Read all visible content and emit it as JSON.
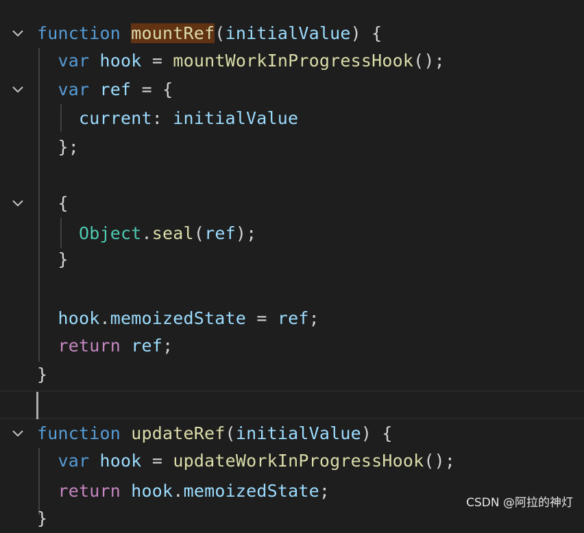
{
  "editor": {
    "lines": [
      {
        "fold": true,
        "tokens": [
          {
            "t": "function",
            "c": "kw"
          },
          {
            "t": " ",
            "c": "pun"
          },
          {
            "t": "mountRef",
            "c": "fn hl"
          },
          {
            "t": "(",
            "c": "pun"
          },
          {
            "t": "initialValue",
            "c": "var"
          },
          {
            "t": ") {",
            "c": "pun"
          }
        ]
      },
      {
        "fold": false,
        "tokens": [
          {
            "t": "  ",
            "c": "pun"
          },
          {
            "t": "var",
            "c": "kw"
          },
          {
            "t": " ",
            "c": "pun"
          },
          {
            "t": "hook",
            "c": "var"
          },
          {
            "t": " = ",
            "c": "pun"
          },
          {
            "t": "mountWorkInProgressHook",
            "c": "fn"
          },
          {
            "t": "();",
            "c": "pun"
          }
        ]
      },
      {
        "fold": true,
        "tokens": [
          {
            "t": "  ",
            "c": "pun"
          },
          {
            "t": "var",
            "c": "kw"
          },
          {
            "t": " ",
            "c": "pun"
          },
          {
            "t": "ref",
            "c": "var"
          },
          {
            "t": " = {",
            "c": "pun"
          }
        ]
      },
      {
        "fold": false,
        "tokens": [
          {
            "t": "    ",
            "c": "pun"
          },
          {
            "t": "current",
            "c": "var"
          },
          {
            "t": ": ",
            "c": "pun"
          },
          {
            "t": "initialValue",
            "c": "var"
          }
        ]
      },
      {
        "fold": false,
        "tokens": [
          {
            "t": "  ",
            "c": "pun"
          },
          {
            "t": "};",
            "c": "pun"
          }
        ]
      },
      {
        "fold": false,
        "tokens": []
      },
      {
        "fold": true,
        "tokens": [
          {
            "t": "  ",
            "c": "pun"
          },
          {
            "t": "{",
            "c": "pun"
          }
        ]
      },
      {
        "fold": false,
        "tokens": [
          {
            "t": "    ",
            "c": "pun"
          },
          {
            "t": "Object",
            "c": "cls"
          },
          {
            "t": ".",
            "c": "pun"
          },
          {
            "t": "seal",
            "c": "fn"
          },
          {
            "t": "(",
            "c": "pun"
          },
          {
            "t": "ref",
            "c": "var"
          },
          {
            "t": ");",
            "c": "pun"
          }
        ]
      },
      {
        "fold": false,
        "tokens": [
          {
            "t": "  ",
            "c": "pun"
          },
          {
            "t": "}",
            "c": "pun"
          }
        ]
      },
      {
        "fold": false,
        "tokens": []
      },
      {
        "fold": false,
        "tokens": [
          {
            "t": "  ",
            "c": "pun"
          },
          {
            "t": "hook",
            "c": "var"
          },
          {
            "t": ".",
            "c": "pun"
          },
          {
            "t": "memoizedState",
            "c": "var"
          },
          {
            "t": " = ",
            "c": "pun"
          },
          {
            "t": "ref",
            "c": "var"
          },
          {
            "t": ";",
            "c": "pun"
          }
        ]
      },
      {
        "fold": false,
        "tokens": [
          {
            "t": "  ",
            "c": "pun"
          },
          {
            "t": "return",
            "c": "ctl"
          },
          {
            "t": " ",
            "c": "pun"
          },
          {
            "t": "ref",
            "c": "var"
          },
          {
            "t": ";",
            "c": "pun"
          }
        ]
      },
      {
        "fold": false,
        "tokens": [
          {
            "t": "}",
            "c": "pun"
          }
        ]
      },
      {
        "fold": false,
        "tokens": []
      },
      {
        "fold": true,
        "tokens": [
          {
            "t": "function",
            "c": "kw"
          },
          {
            "t": " ",
            "c": "pun"
          },
          {
            "t": "updateRef",
            "c": "fn"
          },
          {
            "t": "(",
            "c": "pun"
          },
          {
            "t": "initialValue",
            "c": "var"
          },
          {
            "t": ") {",
            "c": "pun"
          }
        ]
      },
      {
        "fold": false,
        "tokens": [
          {
            "t": "  ",
            "c": "pun"
          },
          {
            "t": "var",
            "c": "kw"
          },
          {
            "t": " ",
            "c": "pun"
          },
          {
            "t": "hook",
            "c": "var"
          },
          {
            "t": " = ",
            "c": "pun"
          },
          {
            "t": "updateWorkInProgressHook",
            "c": "fn"
          },
          {
            "t": "();",
            "c": "pun"
          }
        ]
      },
      {
        "fold": false,
        "tokens": [
          {
            "t": "  ",
            "c": "pun"
          },
          {
            "t": "return",
            "c": "ctl"
          },
          {
            "t": " ",
            "c": "pun"
          },
          {
            "t": "hook",
            "c": "var"
          },
          {
            "t": ".",
            "c": "pun"
          },
          {
            "t": "memoizedState",
            "c": "var"
          },
          {
            "t": ";",
            "c": "pun"
          }
        ]
      },
      {
        "fold": false,
        "tokens": [
          {
            "t": "}",
            "c": "pun"
          }
        ]
      }
    ],
    "fold_icon": "chevron-down-icon",
    "colors": {
      "background": "#1e1e1e",
      "keyword": "#569cd6",
      "function": "#dcdcaa",
      "variable": "#9cdcfe",
      "class": "#4ec9b0",
      "control": "#c586c0",
      "highlight": "#613214"
    }
  },
  "watermark": {
    "text": "CSDN @阿拉的神灯"
  }
}
